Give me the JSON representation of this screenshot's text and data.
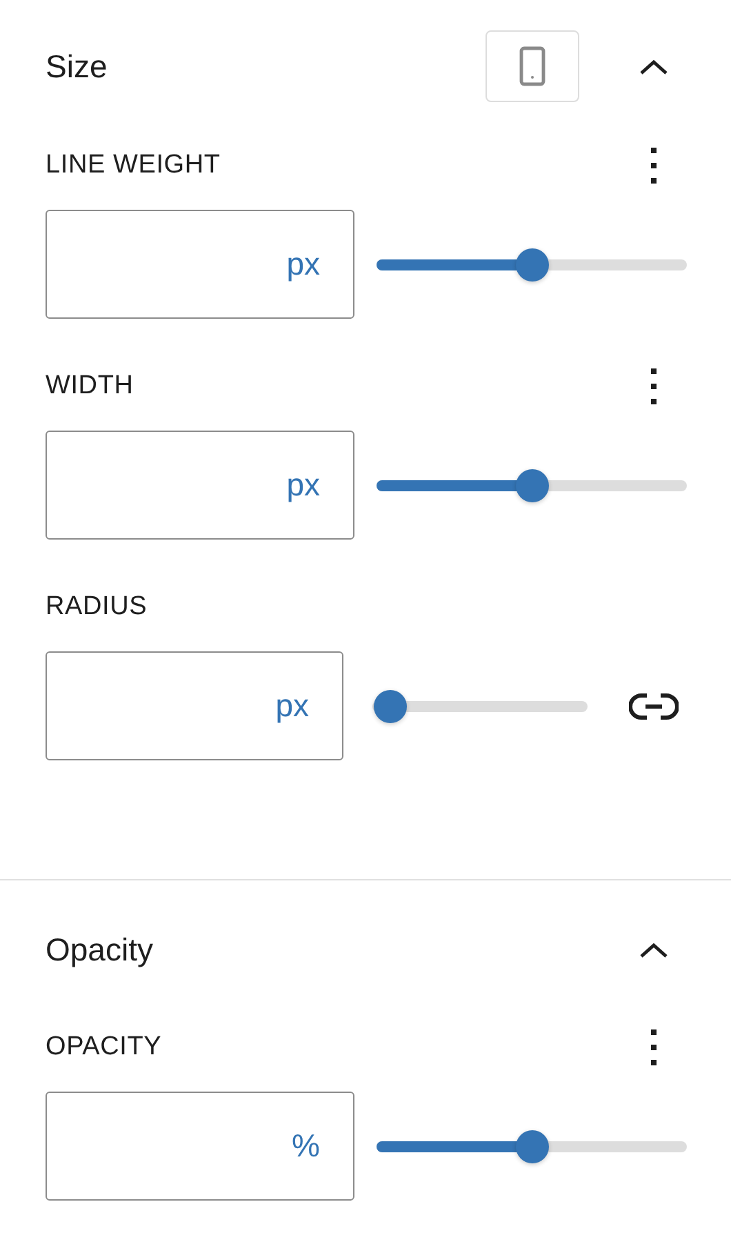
{
  "sections": [
    {
      "title": "Size",
      "expanded": true,
      "device_toggle": true,
      "controls": [
        {
          "kind": "menu",
          "label": "LINE WEIGHT",
          "unit": "px",
          "level": 0.5
        },
        {
          "kind": "menu",
          "label": "WIDTH",
          "unit": "px",
          "level": 0.5
        },
        {
          "kind": "link",
          "label": "RADIUS",
          "unit": "px",
          "level": 0
        }
      ]
    },
    {
      "title": "Opacity",
      "expanded": true,
      "device_toggle": false,
      "controls": [
        {
          "kind": "menu",
          "label": "OPACITY",
          "unit": "%",
          "level": 0.5
        }
      ]
    }
  ]
}
